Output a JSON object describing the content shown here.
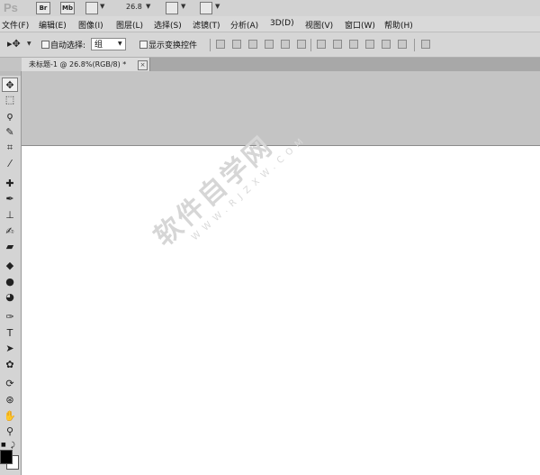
{
  "app": {
    "logo": "Ps",
    "bar_buttons": [
      "Br",
      "Mb"
    ],
    "zoom_level": "26.8"
  },
  "menu": [
    "文件(F)",
    "编辑(E)",
    "图像(I)",
    "图层(L)",
    "选择(S)",
    "滤镜(T)",
    "分析(A)",
    "3D(D)",
    "视图(V)",
    "窗口(W)",
    "帮助(H)"
  ],
  "options": {
    "auto_select_label": "自动选择:",
    "group_value": "组",
    "show_transform_label": "显示变换控件"
  },
  "document": {
    "tab_title": "未标题-1 @ 26.8%(RGB/8) *",
    "close_glyph": "×"
  },
  "watermark": {
    "main": "软件自学网",
    "sub": "WWW.RJZXW.COM"
  },
  "colors": {
    "foreground": "#000000",
    "background": "#ffffff"
  },
  "tools": [
    "move-tool",
    "marquee-tool",
    "lasso-tool",
    "quick-select-tool",
    "crop-tool",
    "eyedropper-tool",
    "healing-brush-tool",
    "brush-tool",
    "clone-stamp-tool",
    "history-brush-tool",
    "eraser-tool",
    "paint-bucket-tool",
    "blur-tool",
    "dodge-tool",
    "pen-tool",
    "type-tool",
    "path-select-tool",
    "shape-tool",
    "3d-rotate-tool",
    "3d-orbit-tool",
    "hand-tool",
    "zoom-tool"
  ]
}
